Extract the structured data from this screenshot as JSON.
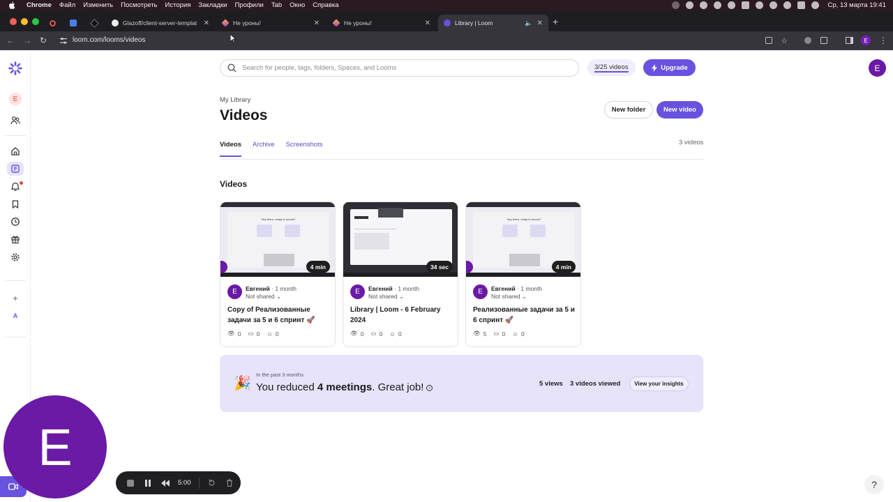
{
  "menubar": {
    "app": "Chrome",
    "items": [
      "Файл",
      "Изменить",
      "Посмотреть",
      "История",
      "Закладки",
      "Профили",
      "Tab",
      "Окно",
      "Справка"
    ],
    "clock": "Ср, 13 марта  19:41"
  },
  "tabs": [
    {
      "label": "Glazoff/client-server-templat",
      "active": false
    },
    {
      "label": "Не уроны!",
      "active": false
    },
    {
      "label": "Не уроны!",
      "active": false
    },
    {
      "label": "Library | Loom",
      "active": true
    }
  ],
  "address": {
    "url": "loom.com/looms/videos",
    "profile_initial": "E"
  },
  "sidebar": {
    "workspace_initial": "E",
    "workspace_letter": "A"
  },
  "header": {
    "search_placeholder": "Search for people, tags, folders, Spaces, and Looms",
    "quota": "3/25 videos",
    "upgrade": "Upgrade",
    "avatar": "E"
  },
  "library": {
    "breadcrumb": "My Library",
    "title": "Videos",
    "new_folder": "New folder",
    "new_video": "New video",
    "tabs": [
      "Videos",
      "Archive",
      "Screenshots"
    ],
    "count": "3 videos",
    "section": "Videos"
  },
  "videos": [
    {
      "duration": "4 min",
      "author": "Евгений",
      "age": "· 1 month",
      "share": "Not shared",
      "title": "Copy of Реализованные задачи за 5 и 6 спринт 🚀",
      "views": "0",
      "comments": "0",
      "reactions": "0",
      "avatar": "E"
    },
    {
      "duration": "34 sec",
      "author": "Евгений",
      "age": "· 1 month",
      "share": "Not shared",
      "title": "Library | Loom - 6 February 2024",
      "views": "0",
      "comments": "0",
      "reactions": "0",
      "avatar": "E"
    },
    {
      "duration": "4 min",
      "author": "Евгений",
      "age": "· 1 month",
      "share": "Not shared",
      "title": "Реализованные задачи за 5 и 6 спринт 🚀",
      "views": "5",
      "comments": "0",
      "reactions": "0",
      "avatar": "E"
    }
  ],
  "thumb_text": "Hey there, ready to record?",
  "insights": {
    "period": "In the past 3 months",
    "pre": "You reduced ",
    "bold": "4 meetings",
    "post": ". Great job!",
    "views": "5 views",
    "viewed": "3 videos viewed",
    "button": "View your insights"
  },
  "recorder": {
    "avatar": "E",
    "time": "5:00"
  },
  "help": "?"
}
